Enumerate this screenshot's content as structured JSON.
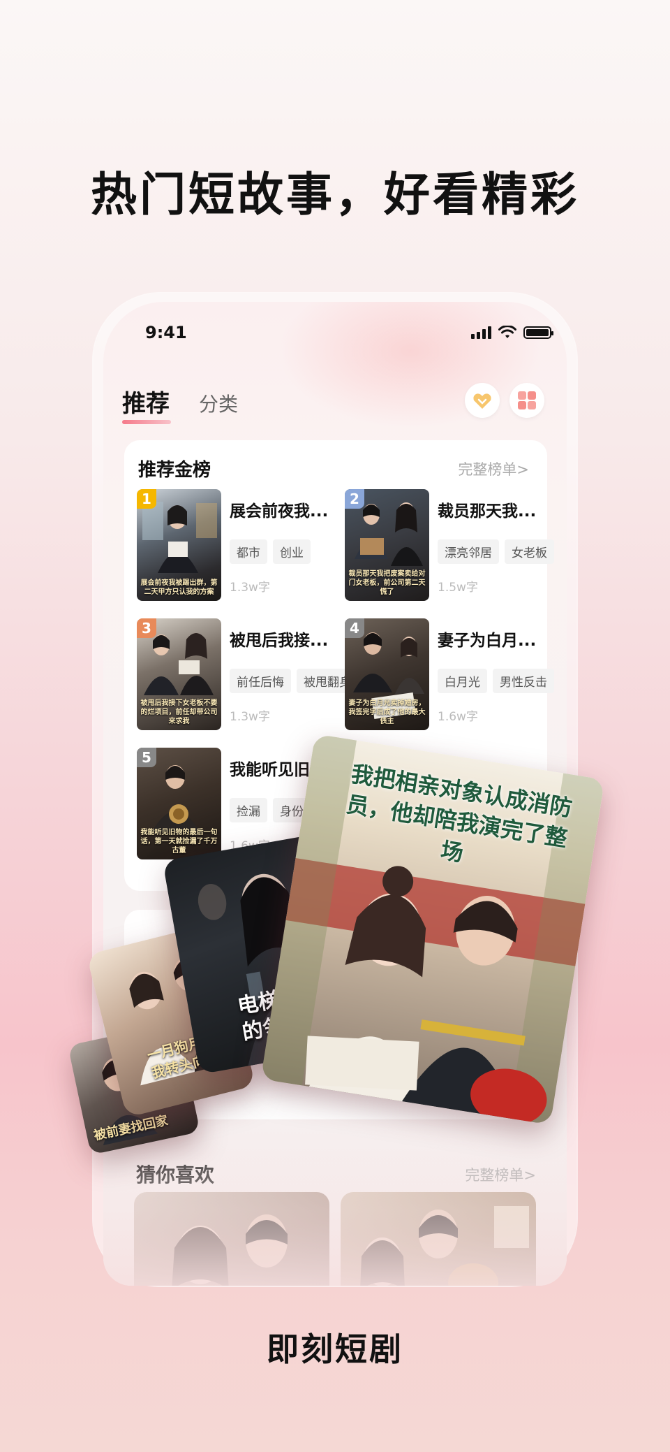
{
  "headline": "热门短故事，好看精彩",
  "status": {
    "time": "9:41"
  },
  "tabs": {
    "recommend": "推荐",
    "category": "分类"
  },
  "ranking": {
    "title": "推荐金榜",
    "link": "完整榜单>",
    "items": [
      {
        "rank": "1",
        "title": "展会前夜我...",
        "tags": [
          "都市",
          "创业"
        ],
        "words": "1.3w字",
        "cover_text": "展会前夜我被踢出群，第二天甲方只认我的方案",
        "rank_color": "#f5b700"
      },
      {
        "rank": "2",
        "title": "裁员那天我...",
        "tags": [
          "漂亮邻居",
          "女老板"
        ],
        "words": "1.5w字",
        "cover_text": "裁员那天我把废案卖给对门女老板，前公司第二天慌了",
        "rank_color": "#8aa6d8"
      },
      {
        "rank": "3",
        "title": "被甩后我接...",
        "tags": [
          "前任后悔",
          "被甩翻身"
        ],
        "words": "1.3w字",
        "cover_text": "被甩后我接下女老板不要的烂项目，前任却带公司来求我",
        "rank_color": "#e88a5a"
      },
      {
        "rank": "4",
        "title": "妻子为白月...",
        "tags": [
          "白月光",
          "男性反击"
        ],
        "words": "1.6w字",
        "cover_text": "妻子为白月光卖掉婚房，我签完字后成了他的最大债主",
        "rank_color": "#888888"
      },
      {
        "rank": "5",
        "title": "我能听见旧...",
        "tags": [
          "捡漏",
          "身份反转"
        ],
        "words": "1.6w字",
        "cover_text": "我能听见旧物的最后一句话，第一天就捡漏了千万古董",
        "rank_color": "#888888"
      }
    ]
  },
  "featured": {
    "main_title": "我把相亲对象认成消防员，他却陪我演完了整场",
    "second_title": "电梯多失踪的邻",
    "third_title": "一月狗月考榜我转头向自己",
    "fourth_title": "被前妻找回家"
  },
  "guess": {
    "title": "猜你喜欢",
    "link": "完整榜单>"
  },
  "footer": "即刻短剧",
  "colors": {
    "accent": "#f57a8a",
    "brand_pink": "#f7c4cb"
  }
}
